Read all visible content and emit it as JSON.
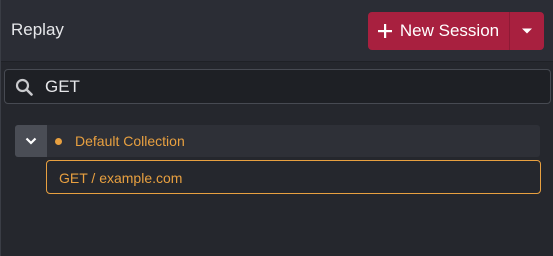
{
  "header": {
    "title": "Replay",
    "new_session_label": "New Session"
  },
  "search": {
    "value": "GET"
  },
  "collection": {
    "name": "Default Collection",
    "sessions": [
      {
        "label": "GET / example.com"
      }
    ]
  },
  "colors": {
    "accent": "#a8203f",
    "highlight": "#e8a040",
    "background": "#25272d"
  },
  "icons": {
    "plus": "plus-icon",
    "caret": "caret-down-icon",
    "search": "search-icon",
    "chevron": "chevron-down-icon"
  }
}
